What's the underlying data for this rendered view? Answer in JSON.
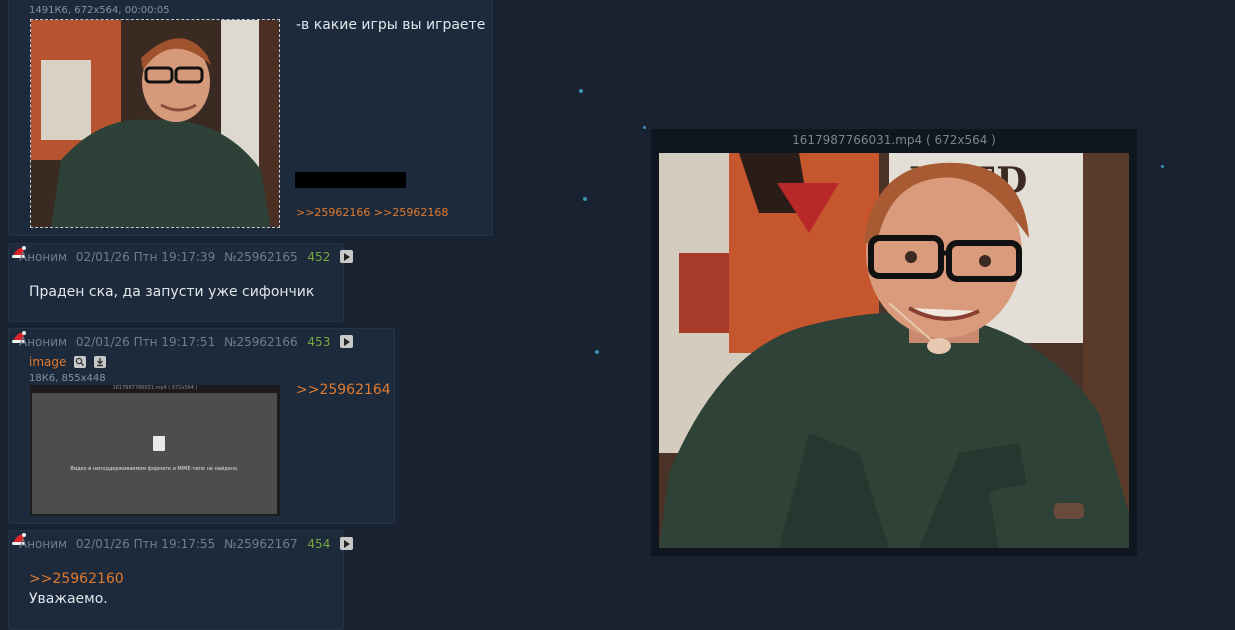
{
  "post_top": {
    "file_info": "1491К6, 672x564, 00:00:05",
    "text": "-в какие игры вы играете",
    "replies": ">>25962166 >>25962168"
  },
  "post_452": {
    "author": "Аноним",
    "date": "02/01/26 Птн 19:17:39",
    "number": "№25962165",
    "index": "452",
    "text": "Праден ска, да запусти уже сифончик"
  },
  "post_453": {
    "author": "Аноним",
    "date": "02/01/26 Птн 19:17:51",
    "number": "№25962166",
    "index": "453",
    "file_name": "image",
    "file_info": "18К6, 855x448",
    "screenshot_title": "1617987766031.mp4 ( 672x564 )",
    "screenshot_error": "Видео в неподдерживаемом формате и MIME-типе не найдено.",
    "reply_link": ">>25962164"
  },
  "post_454": {
    "author": "Аноним",
    "date": "02/01/26 Птн 19:17:55",
    "number": "№25962167",
    "index": "454",
    "reply_link": ">>25962160",
    "text": "Уважаемо."
  },
  "viewer": {
    "title": "1617987766031.mp4 ( 672x564 )"
  },
  "colors": {
    "background": "#182230",
    "post": "#1c2a3b",
    "reply_link": "#e07a2f",
    "index_green": "#76a83e"
  }
}
